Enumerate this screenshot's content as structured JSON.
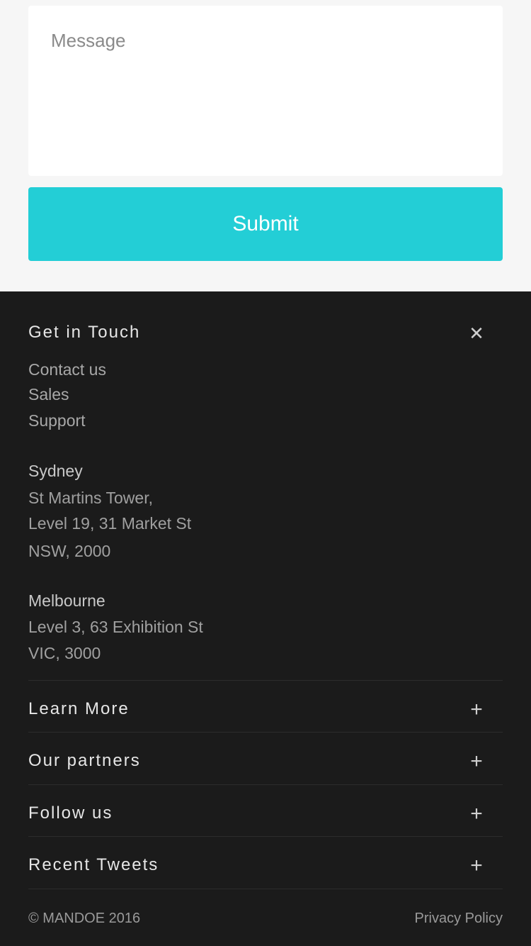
{
  "form": {
    "message_placeholder": "Message",
    "message_value": "",
    "submit_label": "Submit"
  },
  "footer": {
    "get_in_touch": {
      "title": "Get in Touch",
      "toggle_icon": "close-icon",
      "links": [
        "Contact us",
        "Sales",
        "Support"
      ],
      "offices": [
        {
          "name": "Sydney",
          "lines": [
            "St Martins Tower,",
            "Level 19, 31 Market St",
            "NSW, 2000"
          ]
        },
        {
          "name": "Melbourne",
          "lines": [
            "Level 3, 63 Exhibition St",
            "VIC, 3000"
          ]
        }
      ]
    },
    "sections": [
      {
        "title": "Learn More",
        "toggle_icon": "plus-icon"
      },
      {
        "title": "Our partners",
        "toggle_icon": "plus-icon"
      },
      {
        "title": "Follow us",
        "toggle_icon": "plus-icon"
      },
      {
        "title": "Recent Tweets",
        "toggle_icon": "plus-icon"
      }
    ],
    "copyright": "© MANDOE 2016",
    "privacy_link": "Privacy Policy"
  },
  "colors": {
    "accent": "#23ced6",
    "footer_bg": "#1b1b1b",
    "form_bg": "#f6f6f6"
  }
}
